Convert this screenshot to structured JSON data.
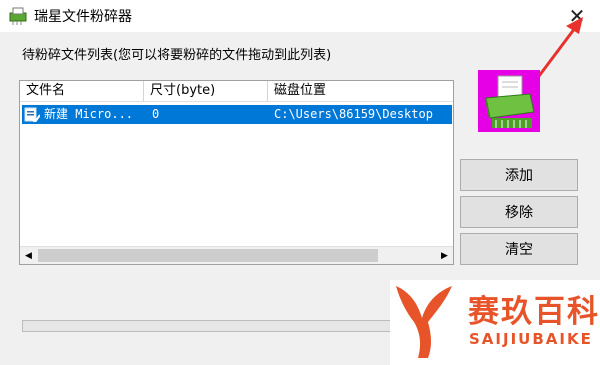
{
  "window": {
    "title": "瑞星文件粉碎器",
    "close_symbol": "✕"
  },
  "list": {
    "caption": "待粉碎文件列表(您可以将要粉碎的文件拖动到此列表)",
    "columns": [
      "文件名",
      "尺寸(byte)",
      "磁盘位置"
    ],
    "rows": [
      {
        "name": "新建 Micro...",
        "size": "0",
        "location": "C:\\Users\\86159\\Desktop"
      }
    ]
  },
  "buttons": {
    "add": "添加",
    "remove": "移除",
    "clear": "清空"
  },
  "watermark": {
    "brand_cn": "赛玖百科",
    "brand_en": "SAIJIUBAIKE"
  },
  "colors": {
    "selection": "#0078d7",
    "annotation_arrow": "#e8312c",
    "brand": "#e8542a",
    "shredder_bg": "#e600e6"
  }
}
